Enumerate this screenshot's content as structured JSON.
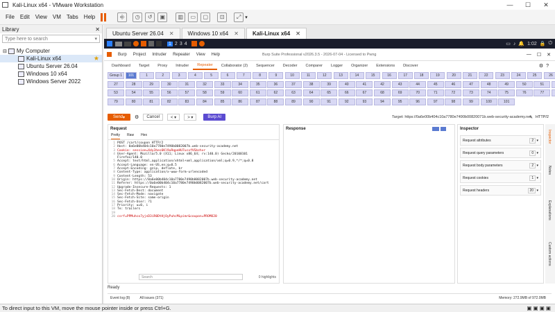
{
  "window": {
    "title": "Kali-Linux x64 - VMware Workstation",
    "min": "—",
    "max": "☐",
    "close": "✕"
  },
  "menu": [
    "File",
    "Edit",
    "View",
    "VM",
    "Tabs",
    "Help"
  ],
  "library": {
    "title": "Library",
    "close": "✕",
    "search_placeholder": "Type here to search",
    "tree": [
      {
        "label": "My Computer"
      },
      {
        "label": "Kali-Linux x64",
        "selected": true,
        "star": "★"
      },
      {
        "label": "Ubuntu Server 26.04"
      },
      {
        "label": "Windows 10 x64"
      },
      {
        "label": "Windows Server 2022"
      }
    ]
  },
  "vm_tabs": [
    {
      "label": "Ubuntu Server 26.04"
    },
    {
      "label": "Windows 10 x64"
    },
    {
      "label": "Kali-Linux x64",
      "active": true
    }
  ],
  "kali": {
    "workspaces": [
      "1",
      "2",
      "3",
      "4"
    ],
    "time": "1:02"
  },
  "burp": {
    "menu": [
      "Burp",
      "Project",
      "Intruder",
      "Repeater",
      "View",
      "Help"
    ],
    "title": "Burp Suite Professional v2026.3.5 - 2026-07-04 - Licensed to Pwng",
    "tabs": [
      "Dashboard",
      "Target",
      "Proxy",
      "Intruder",
      "Repeater",
      "Collaborator (2)",
      "Sequencer",
      "Decoder",
      "Comparer",
      "Logger",
      "Organizer",
      "Extensions",
      "Discover"
    ],
    "active_tab": "Repeater",
    "group_label": "Group 1",
    "group_count": "101",
    "tab_numbers_row1": [
      "1",
      "2",
      "3",
      "4",
      "5",
      "6",
      "7",
      "8",
      "9",
      "10",
      "11",
      "12",
      "13",
      "14",
      "15",
      "16",
      "17",
      "18",
      "19",
      "20",
      "21",
      "22",
      "23",
      "24",
      "25",
      "26"
    ],
    "tab_numbers_row2": [
      "27",
      "28",
      "29",
      "30",
      "31",
      "32",
      "33",
      "34",
      "35",
      "36",
      "37",
      "38",
      "39",
      "40",
      "41",
      "42",
      "43",
      "44",
      "45",
      "46",
      "47",
      "48",
      "49",
      "50",
      "51",
      "52"
    ],
    "tab_numbers_row3": [
      "53",
      "54",
      "55",
      "56",
      "57",
      "58",
      "59",
      "60",
      "61",
      "62",
      "63",
      "64",
      "65",
      "66",
      "67",
      "68",
      "69",
      "70",
      "71",
      "72",
      "73",
      "74",
      "75",
      "76",
      "77",
      "78"
    ],
    "tab_numbers_row4": [
      "79",
      "80",
      "81",
      "82",
      "83",
      "84",
      "85",
      "86",
      "87",
      "88",
      "89",
      "90",
      "91",
      "92",
      "93",
      "94",
      "95",
      "96",
      "97",
      "98",
      "99",
      "100",
      "101"
    ],
    "send_label": "Send",
    "cancel_label": "Cancel",
    "burpai_label": "Burp AI",
    "target_label": "Target: https://0a6e00b404c10a7780e7490b00820071b.web-security-academy.net",
    "http_version": "HTTP/2",
    "request": {
      "title": "Request",
      "subtabs": [
        "Pretty",
        "Raw",
        "Hex"
      ],
      "lines": [
        {
          "n": "1",
          "t": "POST /cart/coupon HTTP/2"
        },
        {
          "n": "2",
          "t": "Host: 0a6e00b404c10a7780e7490b0082007b.web-security-academy.net"
        },
        {
          "n": "3",
          "t": "Cookie: session=Xdy3hes6Kl9uRqpeHU7ucxfVSbzhxr",
          "red": true
        },
        {
          "n": "4",
          "t": "User-Agent: Mozilla/5.0 (X11; Linux x86_64; rv:140.0) Gecko/20100101"
        },
        {
          "n": "",
          "t": "Firefox/140.0"
        },
        {
          "n": "5",
          "t": "Accept: text/html,application/xhtml+xml,application/xml;q=0.9,*/*;q=0.8"
        },
        {
          "n": "6",
          "t": "Accept-Language: en-US,en;q=0.5"
        },
        {
          "n": "7",
          "t": "Accept-Encoding: gzip, deflate, br"
        },
        {
          "n": "8",
          "t": "Content-Type: application/x-www-form-urlencoded"
        },
        {
          "n": "9",
          "t": "Content-Length: 53"
        },
        {
          "n": "10",
          "t": "Origin: https://0a6e00b404c10a7780e7490b0082007b.web-security-academy.net"
        },
        {
          "n": "11",
          "t": "Referer: https://0a6e00b404c10a7780e7490b0082007b.web-security-academy.net/cart"
        },
        {
          "n": "12",
          "t": "Upgrade-Insecure-Requests: 1"
        },
        {
          "n": "13",
          "t": "Sec-Fetch-Dest: document"
        },
        {
          "n": "14",
          "t": "Sec-Fetch-Mode: navigate"
        },
        {
          "n": "15",
          "t": "Sec-Fetch-Site: same-origin"
        },
        {
          "n": "16",
          "t": "Sec-Fetch-User: ?1"
        },
        {
          "n": "17",
          "t": "Priority: u=0, i"
        },
        {
          "n": "18",
          "t": "Te: trailers"
        },
        {
          "n": "19",
          "t": ""
        },
        {
          "n": "20",
          "t": "csrf=PPMuhco7yjsD3iR0DtHjOyPuhcMLpimr&coupon=PROMO20",
          "red": true
        }
      ],
      "search_placeholder": "Search",
      "highlights": "0 highlights"
    },
    "response": {
      "title": "Response"
    },
    "inspector": {
      "title": "Inspector",
      "rows": [
        {
          "label": "Request attributes",
          "count": "2"
        },
        {
          "label": "Request query parameters",
          "count": "0"
        },
        {
          "label": "Request body parameters",
          "count": "2"
        },
        {
          "label": "Request cookies",
          "count": "1"
        },
        {
          "label": "Request headers",
          "count": "20"
        }
      ]
    },
    "side_labels": [
      "Inspector",
      "Notes",
      "Explanations",
      "Custom actions"
    ],
    "ready": "Ready",
    "event_log": "Event log (8)",
    "all_issues": "All issues (371)",
    "memory": "Memory: 272.9MB of 972.0MB"
  },
  "status": "To direct input to this VM, move the mouse pointer inside or press Ctrl+G."
}
